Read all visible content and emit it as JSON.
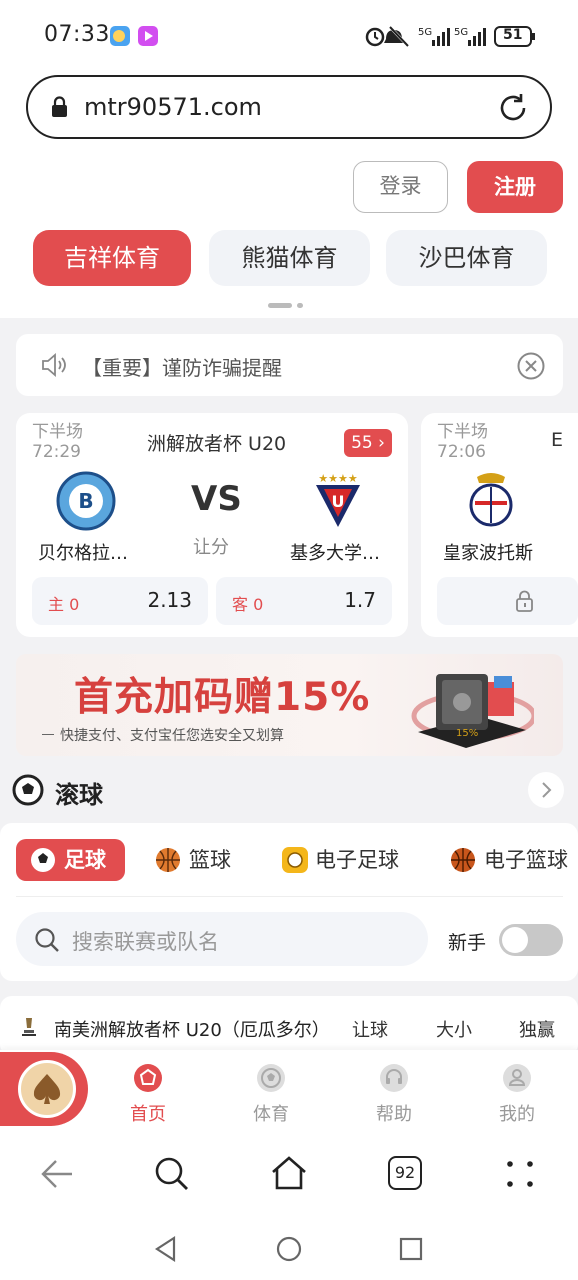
{
  "status": {
    "time": "07:33",
    "battery": "51",
    "network": "5G"
  },
  "browser": {
    "url": "mtr90571.com",
    "tab_count": "92"
  },
  "auth": {
    "login_label": "登录",
    "register_label": "注册"
  },
  "providers": [
    "吉祥体育",
    "熊猫体育",
    "沙巴体育"
  ],
  "notice": {
    "text": "【重要】谨防诈骗提醒"
  },
  "matches": [
    {
      "period": "下半场",
      "clock": "72:29",
      "league": "洲解放者杯 U20",
      "more_count": "55",
      "home": "贝尔格拉…",
      "away": "基多大学…",
      "vs": "VS",
      "market": "让分",
      "home_label": "主 0",
      "home_odds": "2.13",
      "away_label": "客 0",
      "away_odds": "1.7"
    },
    {
      "period": "下半场",
      "clock": "72:06",
      "league": "E",
      "home": "皇家波托斯"
    }
  ],
  "banner": {
    "headline": "首充加码赠15%",
    "subline": "快捷支付、支付宝任您选安全又划算"
  },
  "live": {
    "title": "滚球"
  },
  "sport_tabs": [
    "足球",
    "篮球",
    "电子足球",
    "电子篮球"
  ],
  "search": {
    "placeholder": "搜索联赛或队名"
  },
  "novice": {
    "label": "新手"
  },
  "league_row": {
    "name": "南美洲解放者杯 U20（厄瓜多尔）",
    "cols": [
      "让球",
      "大小",
      "独赢"
    ]
  },
  "nav": [
    "首页",
    "体育",
    "帮助",
    "我的"
  ],
  "colors": {
    "accent": "#e24d4f",
    "page_bg": "#f2f2f4"
  }
}
